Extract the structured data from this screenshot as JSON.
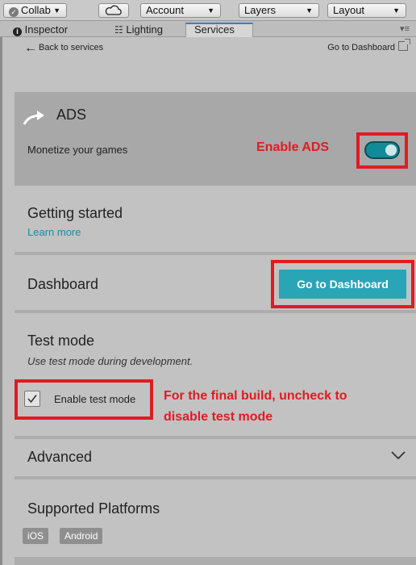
{
  "toolbar": {
    "collab_label": "Collab",
    "account_label": "Account",
    "layers_label": "Layers",
    "layout_label": "Layout"
  },
  "tabs": [
    {
      "label": "Inspector"
    },
    {
      "label": "Lighting"
    },
    {
      "label": "Services"
    }
  ],
  "nav": {
    "back_label": "Back to services",
    "dashboard_link": "Go to Dashboard"
  },
  "ads": {
    "title": "ADS",
    "subtitle": "Monetize your games",
    "toggle_on": true
  },
  "annotations": {
    "enable_ads": "Enable ADS",
    "final_build_line1": "For the final build, uncheck to",
    "final_build_line2": "disable test mode"
  },
  "getting_started": {
    "title": "Getting started",
    "link": "Learn more"
  },
  "dashboard": {
    "title": "Dashboard",
    "button": "Go to Dashboard"
  },
  "test_mode": {
    "title": "Test mode",
    "hint": "Use test mode during development.",
    "checkbox_label": "Enable test mode",
    "checked": true
  },
  "advanced": {
    "title": "Advanced"
  },
  "platforms": {
    "title": "Supported Platforms",
    "items": [
      "iOS",
      "Android"
    ]
  },
  "colors": {
    "accent": "#2aa5b6",
    "annotation": "#e01b22",
    "toggle": "#138a97"
  }
}
